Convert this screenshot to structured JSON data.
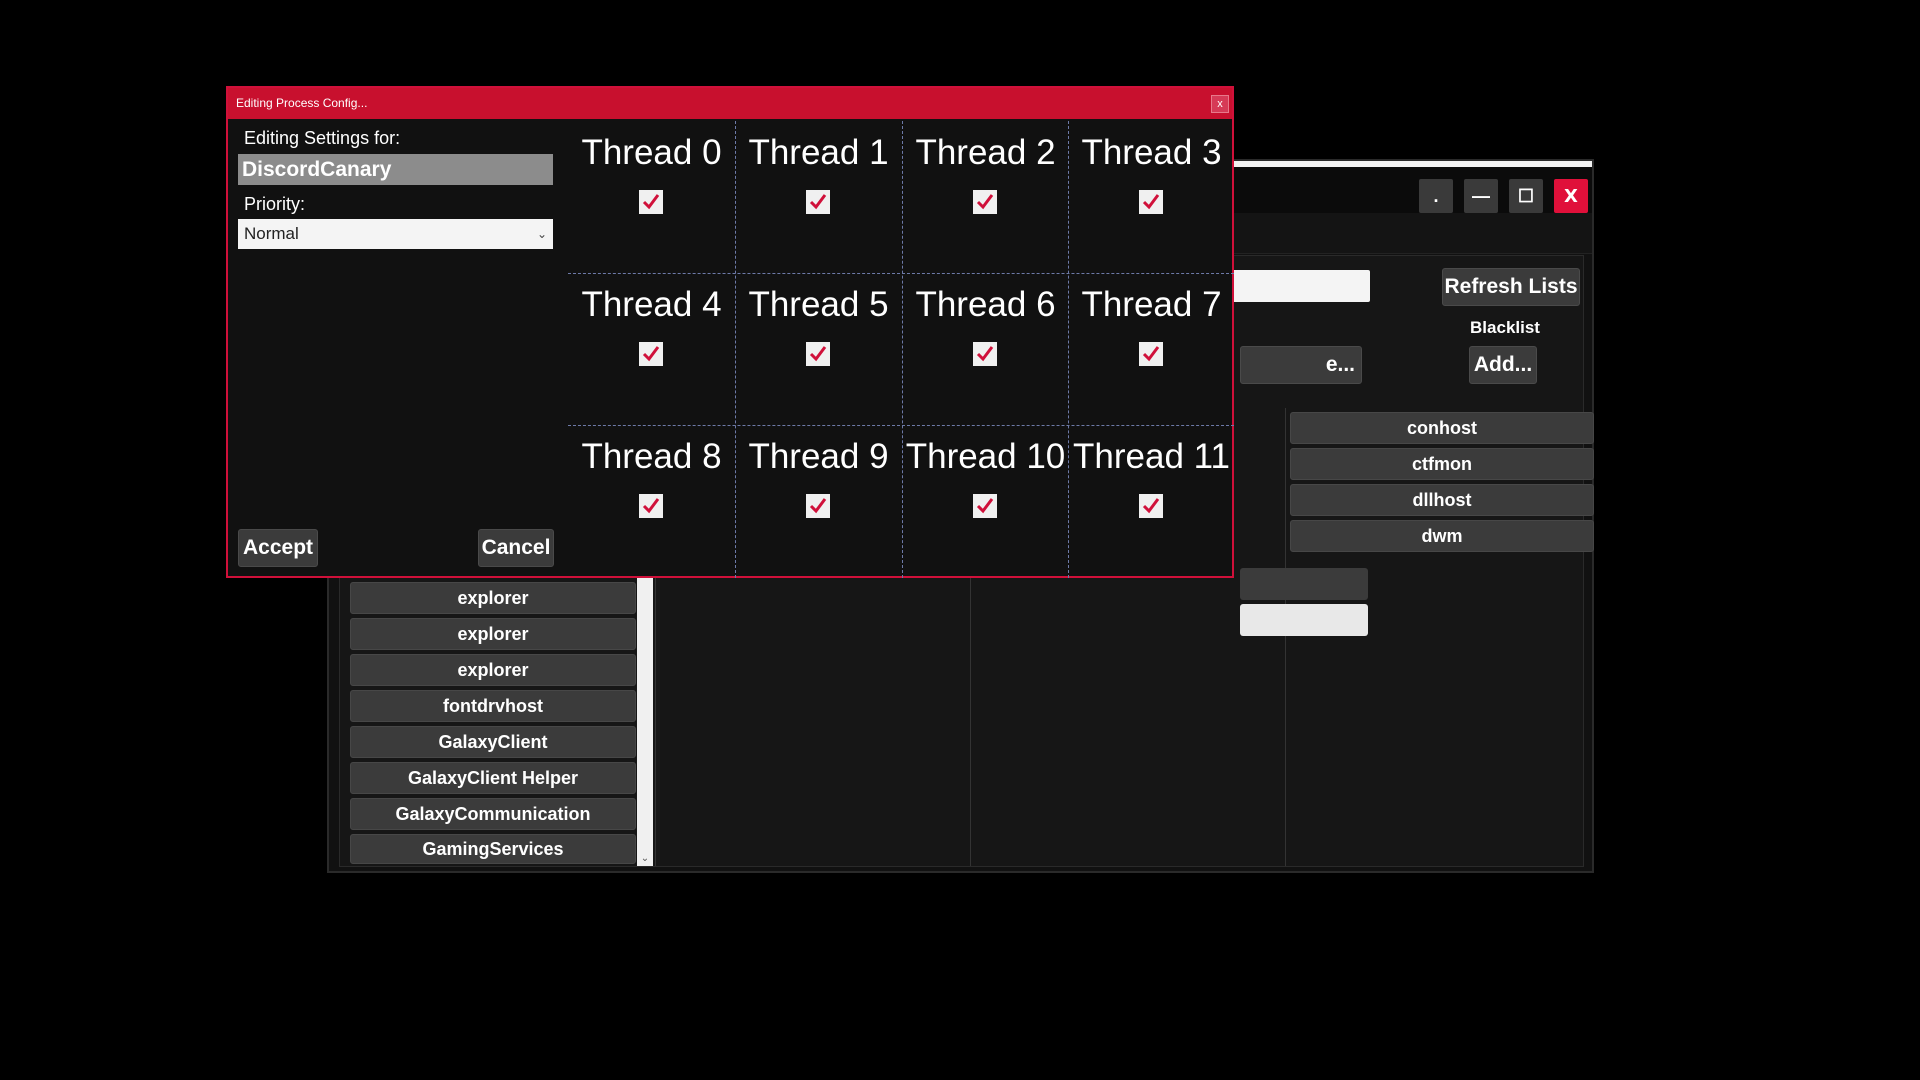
{
  "main_window": {
    "title_buttons": {
      "dot": ".",
      "minimize": "—",
      "maximize": "☐",
      "close": "X"
    },
    "refresh_label": "Refresh Lists",
    "blacklist_label": "Blacklist",
    "blacklist_add_label": "Add...",
    "partial_button_label": "e...",
    "process_list": [
      "explorer",
      "explorer",
      "explorer",
      "fontdrvhost",
      "GalaxyClient",
      "GalaxyClient Helper",
      "GalaxyCommunication",
      "GamingServices"
    ],
    "blacklist_items": [
      "conhost",
      "ctfmon",
      "dllhost",
      "dwm"
    ]
  },
  "dialog": {
    "title": "Editing Process Config...",
    "close": "x",
    "editing_label": "Editing Settings for:",
    "process_name": "DiscordCanary",
    "priority_label": "Priority:",
    "priority_value": "Normal",
    "accept_label": "Accept",
    "cancel_label": "Cancel",
    "threads": [
      {
        "label": "Thread 0",
        "checked": true
      },
      {
        "label": "Thread 1",
        "checked": true
      },
      {
        "label": "Thread 2",
        "checked": true
      },
      {
        "label": "Thread 3",
        "checked": true
      },
      {
        "label": "Thread 4",
        "checked": true
      },
      {
        "label": "Thread 5",
        "checked": true
      },
      {
        "label": "Thread 6",
        "checked": true
      },
      {
        "label": "Thread 7",
        "checked": true
      },
      {
        "label": "Thread 8",
        "checked": true
      },
      {
        "label": "Thread 9",
        "checked": true
      },
      {
        "label": "Thread 10",
        "checked": true
      },
      {
        "label": "Thread 11",
        "checked": true
      }
    ]
  },
  "colors": {
    "accent": "#c8102e",
    "check": "#d0103a",
    "button": "#3b3b3b"
  }
}
